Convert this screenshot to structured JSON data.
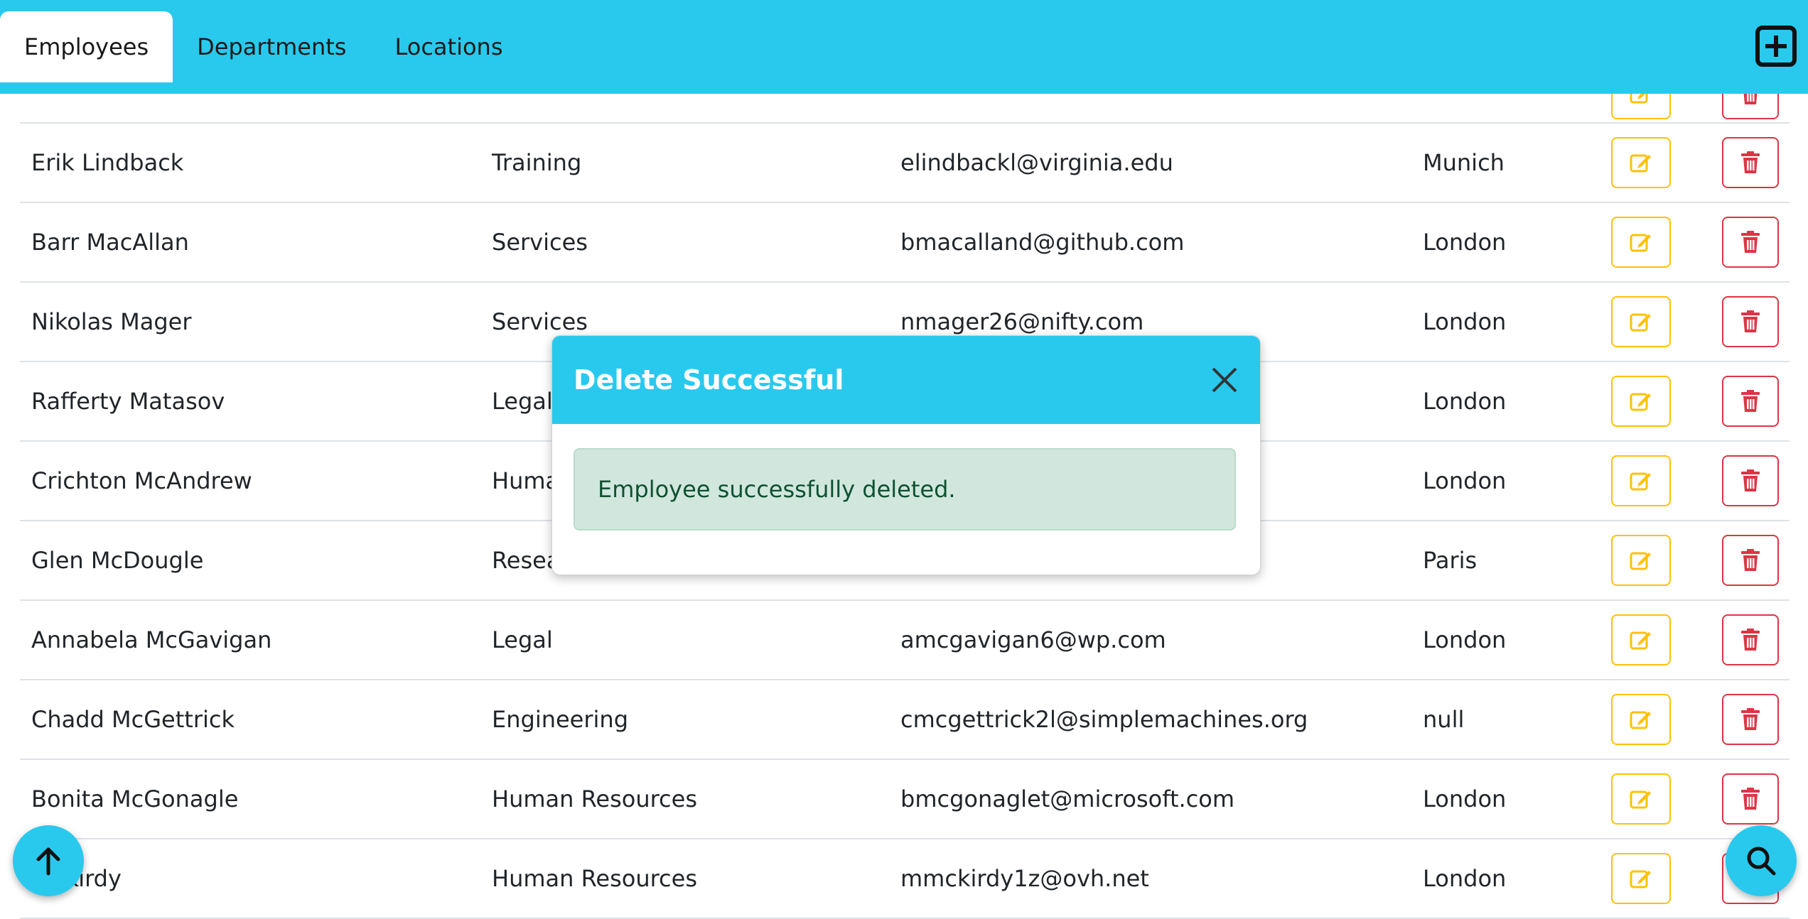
{
  "navbar": {
    "tabs": [
      {
        "label": "Employees",
        "active": true
      },
      {
        "label": "Departments",
        "active": false
      },
      {
        "label": "Locations",
        "active": false
      }
    ],
    "add_icon": "plus-square-icon"
  },
  "table": {
    "rows": [
      {
        "name": "",
        "department": "",
        "email": "",
        "location": ""
      },
      {
        "name": "Erik Lindback",
        "department": "Training",
        "email": "elindbackl@virginia.edu",
        "location": "Munich"
      },
      {
        "name": "Barr MacAllan",
        "department": "Services",
        "email": "bmacalland@github.com",
        "location": "London"
      },
      {
        "name": "Nikolas Mager",
        "department": "Services",
        "email": "nmager26@nifty.com",
        "location": "London"
      },
      {
        "name": "Rafferty Matasov",
        "department": "Legal",
        "email": "",
        "location": "London"
      },
      {
        "name": "Crichton McAndrew",
        "department": "Huma",
        "email": "",
        "location": "London"
      },
      {
        "name": "Glen McDougle",
        "department": "Resea",
        "email": "",
        "location": "Paris"
      },
      {
        "name": "Annabela McGavigan",
        "department": "Legal",
        "email": "amcgavigan6@wp.com",
        "location": "London"
      },
      {
        "name": "Chadd McGettrick",
        "department": "Engineering",
        "email": "cmcgettrick2l@simplemachines.org",
        "location": "null"
      },
      {
        "name": "Bonita McGonagle",
        "department": "Human Resources",
        "email": "bmcgonaglet@microsoft.com",
        "location": "London"
      },
      {
        "name": "McKirdy",
        "department": "Human Resources",
        "email": "mmckirdy1z@ovh.net",
        "location": "London"
      }
    ],
    "edit_icon": "edit-icon",
    "delete_icon": "trash-icon"
  },
  "modal": {
    "title": "Delete Successful",
    "message": "Employee successfully deleted.",
    "close_icon": "close-icon"
  },
  "fabs": {
    "scroll_top_icon": "arrow-up-icon",
    "search_icon": "search-icon"
  },
  "colors": {
    "primary": "#29c9ee",
    "edit": "#ffc107",
    "delete": "#dc3545",
    "success_bg": "#d1e7dd",
    "success_text": "#0f5132"
  }
}
